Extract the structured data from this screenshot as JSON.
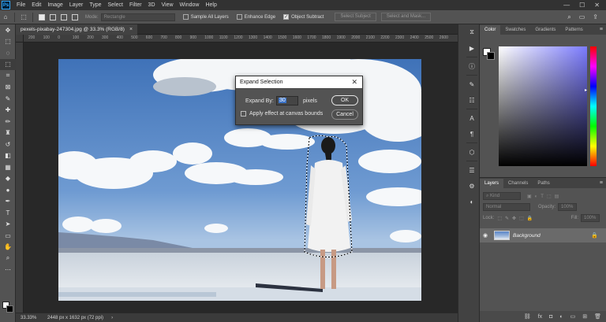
{
  "app": {
    "logo": "Ps"
  },
  "menu": [
    "File",
    "Edit",
    "Image",
    "Layer",
    "Type",
    "Select",
    "Filter",
    "3D",
    "View",
    "Window",
    "Help"
  ],
  "window_controls": {
    "minimize": "—",
    "maximize": "☐",
    "close": "✕"
  },
  "options_bar": {
    "mode_label": "Mode:",
    "mode_value": "Rectangle",
    "sample_all_layers": "Sample All Layers",
    "enhance_edge": "Enhance Edge",
    "object_subtract": "Object Subtract",
    "select_subject": "Select Subject",
    "select_and_mask": "Select and Mask..."
  },
  "document": {
    "tab_title": "pexels-pixabay-247304.jpg @ 33.3% (RGB/8)",
    "close": "×"
  },
  "ruler_ticks": [
    "200",
    "100",
    "0",
    "100",
    "200",
    "300",
    "400",
    "500",
    "600",
    "700",
    "800",
    "900",
    "1000",
    "1100",
    "1200",
    "1300",
    "1400",
    "1500",
    "1600",
    "1700",
    "1800",
    "1900",
    "2000",
    "2100",
    "2200",
    "2300",
    "2400",
    "2500",
    "2600"
  ],
  "status": {
    "zoom": "33.33%",
    "info": "2448 px x 1632 px (72 ppi)",
    "arrow": "›"
  },
  "dialog": {
    "title": "Expand Selection",
    "close": "✕",
    "expand_by_label": "Expand By:",
    "expand_value": "30",
    "unit": "pixels",
    "ok": "OK",
    "cancel": "Cancel",
    "canvas_bounds": "Apply effect at canvas bounds"
  },
  "color_panel": {
    "tabs": [
      "Color",
      "Swatches",
      "Gradients",
      "Patterns"
    ]
  },
  "layers_panel": {
    "tabs": [
      "Layers",
      "Channels",
      "Paths"
    ],
    "kind_placeholder": "Kind",
    "blend_mode": "Normal",
    "opacity_label": "Opacity:",
    "opacity_value": "100%",
    "lock_label": "Lock:",
    "fill_label": "Fill:",
    "fill_value": "100%",
    "layer_name": "Background"
  },
  "colors": {
    "accent": "#31a8ff",
    "selection": "#3b73c8",
    "panel": "#535353"
  }
}
